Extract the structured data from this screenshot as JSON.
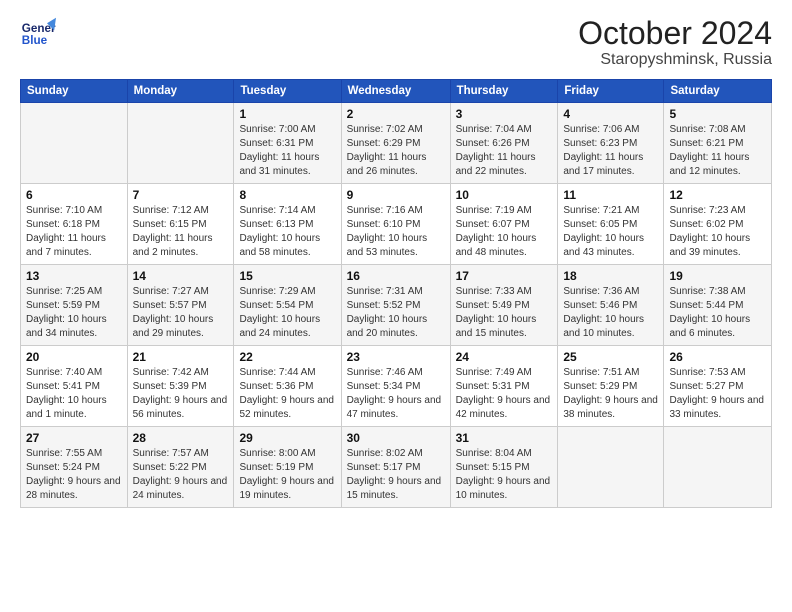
{
  "header": {
    "logo_line1": "General",
    "logo_line2": "Blue",
    "main_title": "October 2024",
    "subtitle": "Staropyshminsk, Russia"
  },
  "days_of_week": [
    "Sunday",
    "Monday",
    "Tuesday",
    "Wednesday",
    "Thursday",
    "Friday",
    "Saturday"
  ],
  "weeks": [
    [
      {
        "day": "",
        "info": ""
      },
      {
        "day": "",
        "info": ""
      },
      {
        "day": "1",
        "info": "Sunrise: 7:00 AM\nSunset: 6:31 PM\nDaylight: 11 hours and 31 minutes."
      },
      {
        "day": "2",
        "info": "Sunrise: 7:02 AM\nSunset: 6:29 PM\nDaylight: 11 hours and 26 minutes."
      },
      {
        "day": "3",
        "info": "Sunrise: 7:04 AM\nSunset: 6:26 PM\nDaylight: 11 hours and 22 minutes."
      },
      {
        "day": "4",
        "info": "Sunrise: 7:06 AM\nSunset: 6:23 PM\nDaylight: 11 hours and 17 minutes."
      },
      {
        "day": "5",
        "info": "Sunrise: 7:08 AM\nSunset: 6:21 PM\nDaylight: 11 hours and 12 minutes."
      }
    ],
    [
      {
        "day": "6",
        "info": "Sunrise: 7:10 AM\nSunset: 6:18 PM\nDaylight: 11 hours and 7 minutes."
      },
      {
        "day": "7",
        "info": "Sunrise: 7:12 AM\nSunset: 6:15 PM\nDaylight: 11 hours and 2 minutes."
      },
      {
        "day": "8",
        "info": "Sunrise: 7:14 AM\nSunset: 6:13 PM\nDaylight: 10 hours and 58 minutes."
      },
      {
        "day": "9",
        "info": "Sunrise: 7:16 AM\nSunset: 6:10 PM\nDaylight: 10 hours and 53 minutes."
      },
      {
        "day": "10",
        "info": "Sunrise: 7:19 AM\nSunset: 6:07 PM\nDaylight: 10 hours and 48 minutes."
      },
      {
        "day": "11",
        "info": "Sunrise: 7:21 AM\nSunset: 6:05 PM\nDaylight: 10 hours and 43 minutes."
      },
      {
        "day": "12",
        "info": "Sunrise: 7:23 AM\nSunset: 6:02 PM\nDaylight: 10 hours and 39 minutes."
      }
    ],
    [
      {
        "day": "13",
        "info": "Sunrise: 7:25 AM\nSunset: 5:59 PM\nDaylight: 10 hours and 34 minutes."
      },
      {
        "day": "14",
        "info": "Sunrise: 7:27 AM\nSunset: 5:57 PM\nDaylight: 10 hours and 29 minutes."
      },
      {
        "day": "15",
        "info": "Sunrise: 7:29 AM\nSunset: 5:54 PM\nDaylight: 10 hours and 24 minutes."
      },
      {
        "day": "16",
        "info": "Sunrise: 7:31 AM\nSunset: 5:52 PM\nDaylight: 10 hours and 20 minutes."
      },
      {
        "day": "17",
        "info": "Sunrise: 7:33 AM\nSunset: 5:49 PM\nDaylight: 10 hours and 15 minutes."
      },
      {
        "day": "18",
        "info": "Sunrise: 7:36 AM\nSunset: 5:46 PM\nDaylight: 10 hours and 10 minutes."
      },
      {
        "day": "19",
        "info": "Sunrise: 7:38 AM\nSunset: 5:44 PM\nDaylight: 10 hours and 6 minutes."
      }
    ],
    [
      {
        "day": "20",
        "info": "Sunrise: 7:40 AM\nSunset: 5:41 PM\nDaylight: 10 hours and 1 minute."
      },
      {
        "day": "21",
        "info": "Sunrise: 7:42 AM\nSunset: 5:39 PM\nDaylight: 9 hours and 56 minutes."
      },
      {
        "day": "22",
        "info": "Sunrise: 7:44 AM\nSunset: 5:36 PM\nDaylight: 9 hours and 52 minutes."
      },
      {
        "day": "23",
        "info": "Sunrise: 7:46 AM\nSunset: 5:34 PM\nDaylight: 9 hours and 47 minutes."
      },
      {
        "day": "24",
        "info": "Sunrise: 7:49 AM\nSunset: 5:31 PM\nDaylight: 9 hours and 42 minutes."
      },
      {
        "day": "25",
        "info": "Sunrise: 7:51 AM\nSunset: 5:29 PM\nDaylight: 9 hours and 38 minutes."
      },
      {
        "day": "26",
        "info": "Sunrise: 7:53 AM\nSunset: 5:27 PM\nDaylight: 9 hours and 33 minutes."
      }
    ],
    [
      {
        "day": "27",
        "info": "Sunrise: 7:55 AM\nSunset: 5:24 PM\nDaylight: 9 hours and 28 minutes."
      },
      {
        "day": "28",
        "info": "Sunrise: 7:57 AM\nSunset: 5:22 PM\nDaylight: 9 hours and 24 minutes."
      },
      {
        "day": "29",
        "info": "Sunrise: 8:00 AM\nSunset: 5:19 PM\nDaylight: 9 hours and 19 minutes."
      },
      {
        "day": "30",
        "info": "Sunrise: 8:02 AM\nSunset: 5:17 PM\nDaylight: 9 hours and 15 minutes."
      },
      {
        "day": "31",
        "info": "Sunrise: 8:04 AM\nSunset: 5:15 PM\nDaylight: 9 hours and 10 minutes."
      },
      {
        "day": "",
        "info": ""
      },
      {
        "day": "",
        "info": ""
      }
    ]
  ]
}
